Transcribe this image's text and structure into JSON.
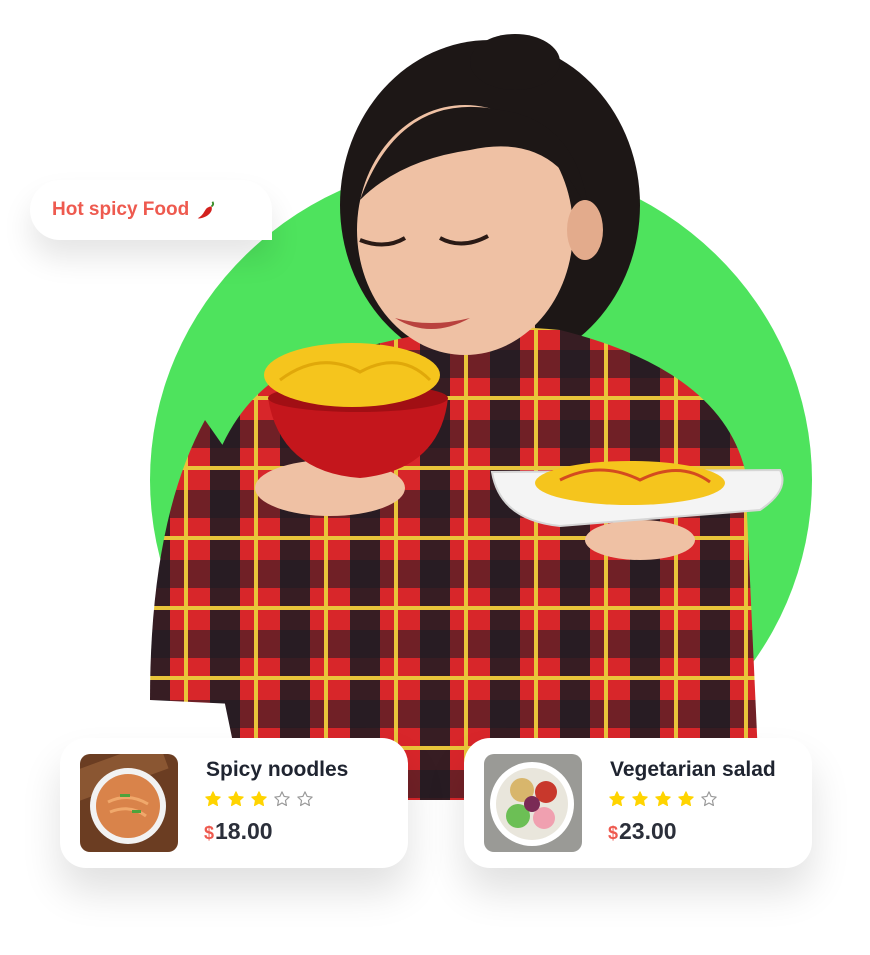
{
  "bubble": {
    "text": "Hot spicy Food",
    "icon": "chili-pepper-icon"
  },
  "colors": {
    "accent_green": "#4ee35d",
    "accent_red": "#ee5a4f",
    "star_yellow": "#ffd400"
  },
  "products": [
    {
      "name": "Spicy noodles",
      "rating": 3,
      "max_rating": 5,
      "currency": "$",
      "price": "18.00"
    },
    {
      "name": "Vegetarian salad",
      "rating": 4,
      "max_rating": 5,
      "currency": "$",
      "price": "23.00"
    }
  ]
}
